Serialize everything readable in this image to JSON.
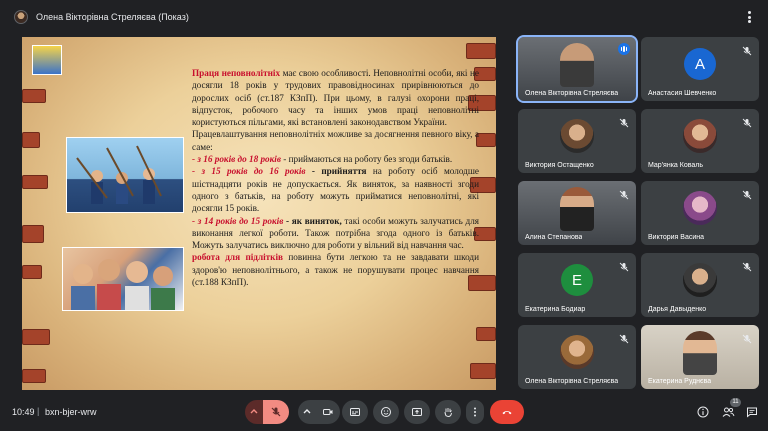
{
  "window": {
    "presenter_label": "Олена Вікторівна Стреляєва (Показ)"
  },
  "slide": {
    "title_red": "Праця неповнолітніх",
    "title_rest": " має свою особливості.",
    "para1": " Неповнолітні особи, які не досягли 18 років у трудових правовідносинах прирівнюються до дорослих осіб (ст.187 КЗпП). При цьому, в галузі охорони праці, відпусток, робочого часу та інших умов праці неповнолітні користуються пільгами, які встановлені законодавством України.",
    "para2": "Працевлаштування неповнолітніх можливе за досягнення певного віку, а саме:",
    "item1_red": "- з 16 років до 18 років",
    "item1_rest": " - приймаються на роботу без згоди батьків.",
    "item2_red": "- з 15 років до 16 років",
    "item2_bold": " - прийняття",
    "item2_rest": " на роботу осіб молодше шістнадцяти років не допускається. Як виняток, за наявності згоди одного з батьків, на роботу можуть прийматися неповнолітні, які досягли 15 років.",
    "item3_red": "- з 14 років до 15 років",
    "item3_bold": " - як виняток,",
    "item3_rest": " такі особи можуть залучатись для виконання легкої роботи. Також потрібна згода одного із батьків. Можуть залучатись виключно для роботи у вільний від навчання час.",
    "item4_red": "робота для підлітків",
    "item4_rest": " повинна бути легкою та не завдавати шкоди здоров'ю неповнолітнього, а також не порушувати процес навчання (ст.188 КЗпП)."
  },
  "participants": [
    {
      "name": "Олена Вікторівна Стреляєва",
      "type": "video",
      "speaking": true
    },
    {
      "name": "Анастасия Шевченко",
      "type": "avatar",
      "initial": "A",
      "color": "#1967d2",
      "muted": true
    },
    {
      "name": "Виктория Остащенко",
      "type": "photo",
      "muted": true
    },
    {
      "name": "Мар'янка Коваль",
      "type": "photo",
      "muted": true
    },
    {
      "name": "Алина Степанова",
      "type": "video",
      "muted": true
    },
    {
      "name": "Виктория Васина",
      "type": "photo",
      "muted": true
    },
    {
      "name": "Екатерина Бодиар",
      "type": "avatar",
      "initial": "E",
      "color": "#1e8e3e",
      "muted": true
    },
    {
      "name": "Дарья Давыденко",
      "type": "photo",
      "muted": true
    },
    {
      "name": "Олена Вікторівна Стреляєва",
      "type": "photo",
      "muted": true
    },
    {
      "name": "Екатерина Руднєва",
      "type": "video",
      "muted": true
    }
  ],
  "bottombar": {
    "time": "10:49",
    "separator": "|",
    "meeting_code": "bxn-bjer-wrw",
    "people_count": "11"
  },
  "colors": {
    "background": "#202124",
    "tile": "#3c4043",
    "hangup": "#ea4335",
    "accent": "#8ab4f8"
  }
}
